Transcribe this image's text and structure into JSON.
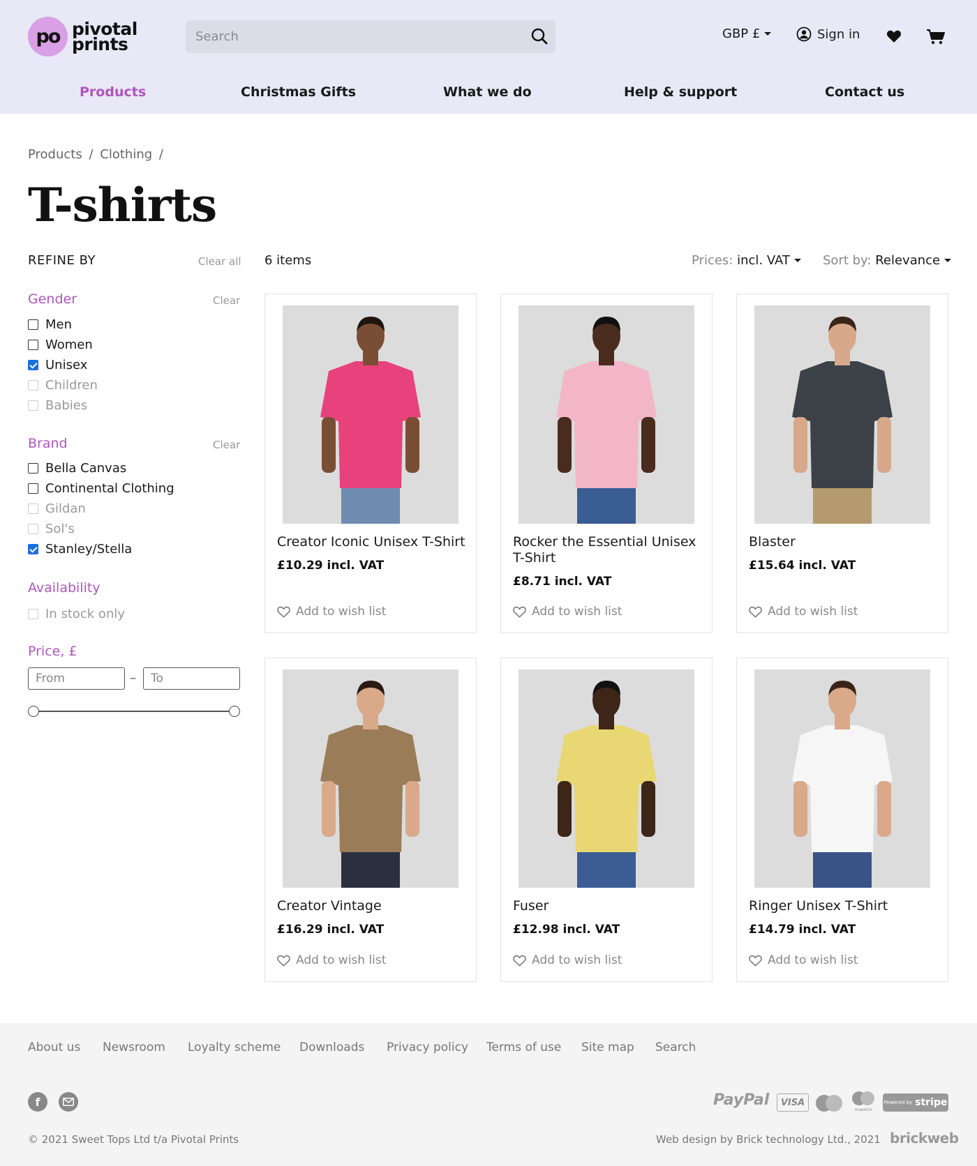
{
  "header": {
    "logo_mark": "po",
    "logo_line1": "pivotal",
    "logo_line2": "prints",
    "search_placeholder": "Search",
    "currency": "GBP £",
    "sign_in": "Sign in"
  },
  "nav": [
    {
      "label": "Products",
      "active": true
    },
    {
      "label": "Christmas Gifts"
    },
    {
      "label": "What we do"
    },
    {
      "label": "Help & support"
    },
    {
      "label": "Contact us"
    }
  ],
  "breadcrumb": [
    "Products",
    "/",
    "Clothing",
    "/"
  ],
  "page_title": "T-shirts",
  "sidebar": {
    "refine_label": "REFINE BY",
    "clear_all": "Clear all",
    "gender": {
      "title": "Gender",
      "clear": "Clear",
      "options": [
        {
          "label": "Men",
          "checked": false,
          "disabled": false
        },
        {
          "label": "Women",
          "checked": false,
          "disabled": false
        },
        {
          "label": "Unisex",
          "checked": true,
          "disabled": false
        },
        {
          "label": "Children",
          "checked": false,
          "disabled": true
        },
        {
          "label": "Babies",
          "checked": false,
          "disabled": true
        }
      ]
    },
    "brand": {
      "title": "Brand",
      "clear": "Clear",
      "options": [
        {
          "label": "Bella Canvas",
          "checked": false,
          "disabled": false
        },
        {
          "label": "Continental Clothing",
          "checked": false,
          "disabled": false
        },
        {
          "label": "Gildan",
          "checked": false,
          "disabled": true
        },
        {
          "label": "Sol's",
          "checked": false,
          "disabled": true
        },
        {
          "label": "Stanley/Stella",
          "checked": true,
          "disabled": false
        }
      ]
    },
    "availability": {
      "title": "Availability",
      "options": [
        {
          "label": "In stock only",
          "checked": false,
          "disabled": true
        }
      ]
    },
    "price": {
      "title": "Price, £",
      "from_placeholder": "From",
      "to_placeholder": "To",
      "separator": "–"
    }
  },
  "results": {
    "count": "6 items",
    "prices_label": "Prices:",
    "prices_value": "incl. VAT",
    "sort_label": "Sort by:",
    "sort_value": "Relevance"
  },
  "products": [
    {
      "name": "Creator Iconic Unisex T-Shirt",
      "price": "£10.29 incl. VAT",
      "wish": "Add to wish list",
      "shirt_color": "#e8427c",
      "pants_color": "#6f8bb0",
      "skin": "#7a4e35",
      "hair": "#1e1410"
    },
    {
      "name": "Rocker the Essential Unisex T-Shirt",
      "price": "£8.71 incl. VAT",
      "wish": "Add to wish list",
      "shirt_color": "#f2b6c8",
      "pants_color": "#3a5d94",
      "skin": "#4a2c1e",
      "hair": "#111"
    },
    {
      "name": "Blaster",
      "price": "£15.64 incl. VAT",
      "wish": "Add to wish list",
      "shirt_color": "#3c4148",
      "pants_color": "#b59a6e",
      "skin": "#d7a88a",
      "hair": "#3a2418"
    },
    {
      "name": "Creator Vintage",
      "price": "£16.29 incl. VAT",
      "wish": "Add to wish list",
      "shirt_color": "#9a7c58",
      "pants_color": "#2b3040",
      "skin": "#d9a98a",
      "hair": "#2a1a12"
    },
    {
      "name": "Fuser",
      "price": "£12.98 incl. VAT",
      "wish": "Add to wish list",
      "shirt_color": "#e8d772",
      "pants_color": "#3b5c95",
      "skin": "#3d2518",
      "hair": "#111"
    },
    {
      "name": "Ringer Unisex T-Shirt",
      "price": "£14.79 incl. VAT",
      "wish": "Add to wish list",
      "shirt_color": "#f6f6f6",
      "pants_color": "#3a5387",
      "skin": "#d9a98a",
      "hair": "#3a2418"
    }
  ],
  "footer": {
    "links": [
      "About us",
      "Newsroom",
      "Loyalty scheme",
      "Downloads",
      "Privacy policy",
      "Terms of use",
      "Site map",
      "Search"
    ],
    "copyright": "© 2021 Sweet Tops Ltd t/a Pivotal Prints",
    "credit": "Web design by Brick technology Ltd., 2021",
    "credit_brand": "brickweb",
    "payment": {
      "paypal": "PayPal",
      "visa": "VISA",
      "maestro": "maestro",
      "stripe_small": "Powered by",
      "stripe": "stripe"
    }
  },
  "colors": {
    "accent": "#b055c0",
    "header_bg": "#e8e8f6",
    "checkbox": "#1a6fe0"
  }
}
